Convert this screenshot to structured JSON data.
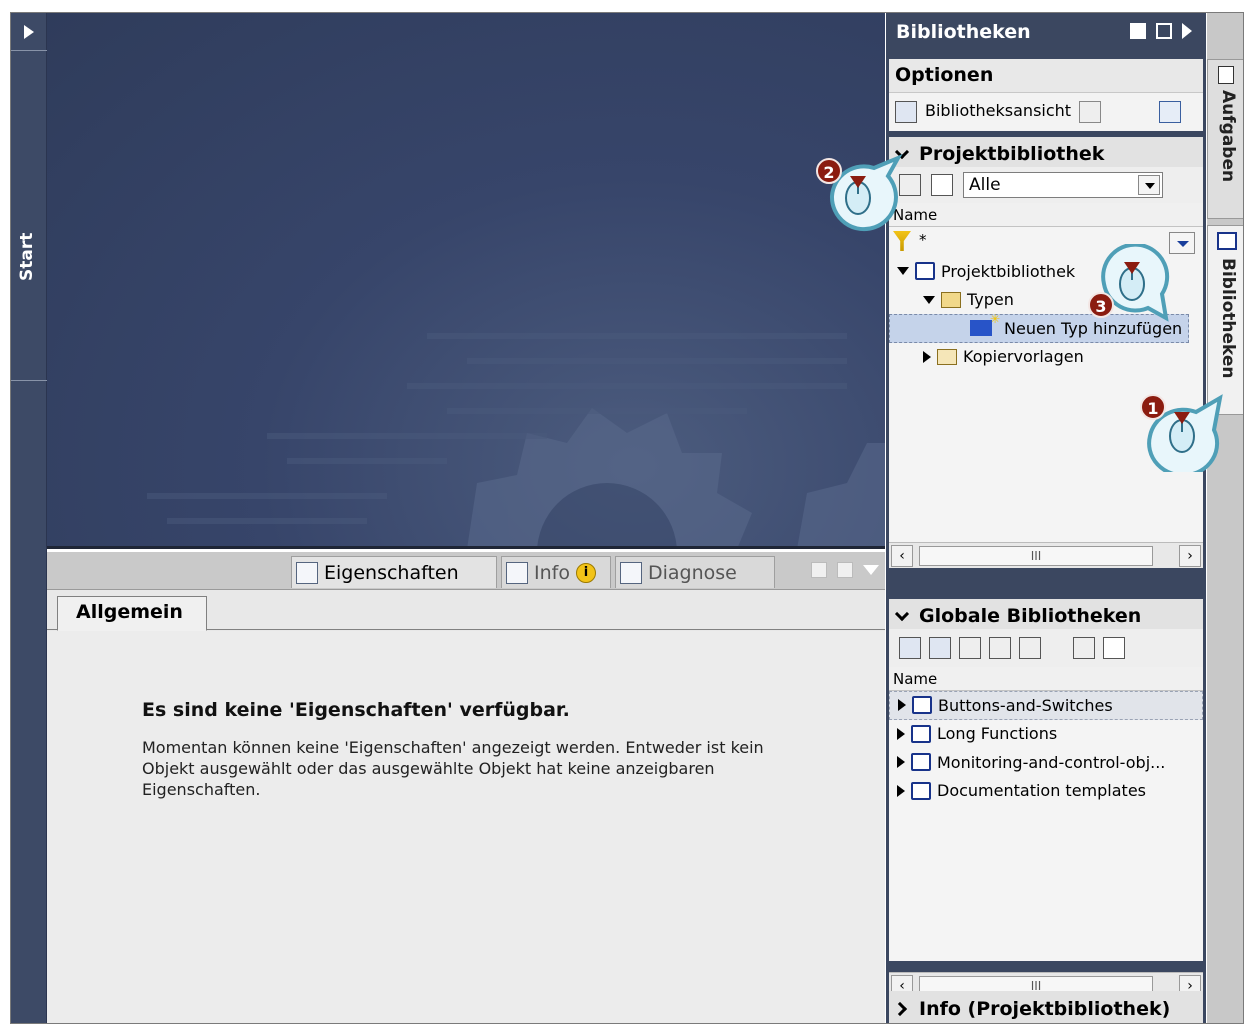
{
  "start_strip": {
    "tab_label": "Start"
  },
  "properties": {
    "tabs": [
      {
        "label": "Eigenschaften"
      },
      {
        "label": "Info"
      },
      {
        "label": "Diagnose"
      }
    ],
    "info_badge": "i",
    "subtab": "Allgemein",
    "heading": "Es sind keine 'Eigenschaften' verfügbar.",
    "message": "Momentan können keine 'Eigenschaften' angezeigt werden. Entweder ist kein Objekt ausgewählt oder das ausgewählte Objekt hat keine anzeigbaren Eigenschaften."
  },
  "libraries": {
    "title": "Bibliotheken",
    "options_label": "Optionen",
    "library_view_label": "Bibliotheksansicht",
    "project_section": {
      "title": "Projektbibliothek",
      "filter_value": "Alle",
      "column_name": "Name",
      "filter_text": "*",
      "tree": [
        {
          "label": "Projektbibliothek"
        },
        {
          "label": "Typen"
        },
        {
          "label": "Neuen Typ hinzufügen"
        },
        {
          "label": "Kopiervorlagen"
        }
      ],
      "scroll_thumb": "III"
    },
    "global_section": {
      "title": "Globale Bibliotheken",
      "column_name": "Name",
      "items": [
        {
          "label": "Buttons-and-Switches"
        },
        {
          "label": "Long Functions"
        },
        {
          "label": "Monitoring-and-control-obj..."
        },
        {
          "label": "Documentation templates"
        }
      ],
      "scroll_thumb": "III"
    },
    "info_section": {
      "title": "Info (Projektbibliothek)"
    }
  },
  "side_tabs": [
    {
      "label": "Aufgaben"
    },
    {
      "label": "Bibliotheken"
    }
  ],
  "callouts": [
    {
      "number": "1"
    },
    {
      "number": "2"
    },
    {
      "number": "3"
    }
  ],
  "colors": {
    "workarea": "#37456a",
    "pane_dark": "#3b4760",
    "selection": "#c5d3ea",
    "callout_number": "#8b1c10",
    "callout_outline": "#4f9fb7"
  }
}
